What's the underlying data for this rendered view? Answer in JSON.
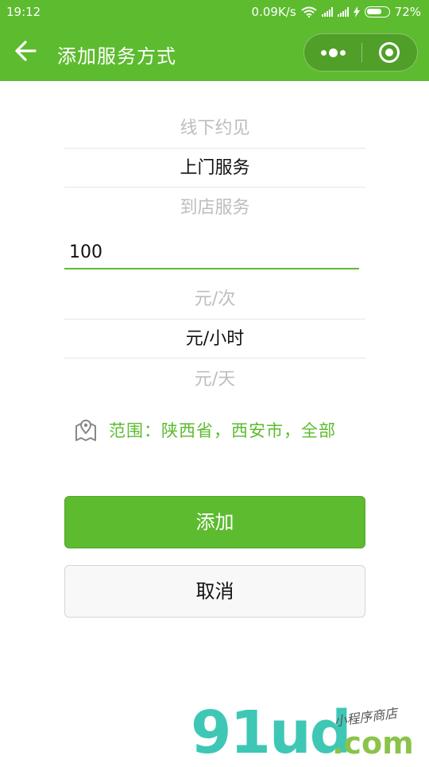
{
  "status_bar": {
    "time": "19:12",
    "net_speed": "0.09K/s",
    "battery": "72%",
    "battery_level": 0.72
  },
  "header": {
    "title": "添加服务方式",
    "back_icon": "arrow-left-icon",
    "menu_icon": "more-dots-icon",
    "close_icon": "target-circle-icon",
    "bg_color": "#5dbb2f"
  },
  "service_type_picker": {
    "options": [
      "线下约见",
      "上门服务",
      "到店服务"
    ],
    "selected": "上门服务"
  },
  "price": {
    "value": "100"
  },
  "unit_picker": {
    "options": [
      "元/次",
      "元/小时",
      "元/天"
    ],
    "selected": "元/小时"
  },
  "range": {
    "icon": "map-pin-icon",
    "label": "范围：陕西省，西安市，全部"
  },
  "buttons": {
    "add": "添加",
    "cancel": "取消"
  },
  "watermark": {
    "main": "91ud",
    "domain": ".com",
    "tagline": "小程序商店"
  },
  "colors": {
    "accent": "#5dbb2f",
    "muted_text": "#bdbdbd",
    "watermark_teal": "#3fc7b5"
  }
}
